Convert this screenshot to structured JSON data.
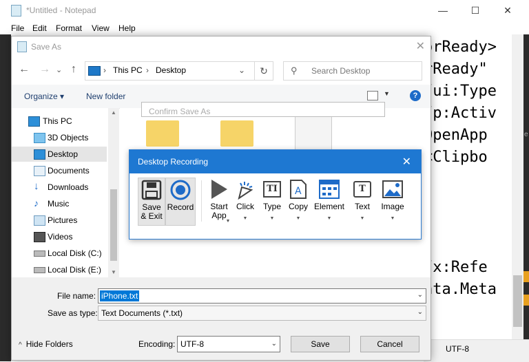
{
  "notepad": {
    "title": "*Untitled - Notepad",
    "menu": [
      "File",
      "Edit",
      "Format",
      "View",
      "Help"
    ],
    "code_lines": [
      "orReady>",
      "rReady\"",
      "/ui:Type",
      "/p:Activ",
      "OpenApp",
      "<Clipbo",
      "",
      "",
      "",
      "/x:Refe",
      "ata.Meta"
    ],
    "status_encoding": "UTF-8"
  },
  "saveas": {
    "title": "Save As",
    "address": [
      "This PC",
      "Desktop"
    ],
    "search_placeholder": "Search Desktop",
    "toolbar": {
      "organize": "Organize",
      "new_folder": "New folder"
    },
    "tree": [
      {
        "label": "This PC",
        "icon": "computer-icon",
        "indent": 0
      },
      {
        "label": "3D Objects",
        "icon": "cube-icon",
        "indent": 1
      },
      {
        "label": "Desktop",
        "icon": "desktop-icon",
        "indent": 1,
        "selected": true
      },
      {
        "label": "Documents",
        "icon": "documents-icon",
        "indent": 1
      },
      {
        "label": "Downloads",
        "icon": "download-icon",
        "indent": 1
      },
      {
        "label": "Music",
        "icon": "music-icon",
        "indent": 1
      },
      {
        "label": "Pictures",
        "icon": "pictures-icon",
        "indent": 1
      },
      {
        "label": "Videos",
        "icon": "videos-icon",
        "indent": 1
      },
      {
        "label": "Local Disk (C:)",
        "icon": "drive-icon",
        "indent": 1
      },
      {
        "label": "Local Disk (E:)",
        "icon": "drive-icon",
        "indent": 1
      }
    ],
    "confirm_behind_title": "Confirm Save As",
    "file_name_label": "File name:",
    "file_name_value": "iPhone.txt",
    "save_type_label": "Save as type:",
    "save_type_value": "Text Documents (*.txt)",
    "hide_folders": "Hide Folders",
    "encoding_label": "Encoding:",
    "encoding_value": "UTF-8",
    "save_button": "Save",
    "cancel_button": "Cancel"
  },
  "recorder": {
    "title": "Desktop Recording",
    "tools": [
      {
        "id": "save-exit",
        "label": "Save\n& Exit",
        "icon": "save-icon",
        "active": true
      },
      {
        "id": "record",
        "label": "Record",
        "icon": "record-icon",
        "active": true
      },
      {
        "id": "start-app",
        "label": "Start\nApp",
        "icon": "play-icon",
        "dropdown": true
      },
      {
        "id": "click",
        "label": "Click",
        "icon": "cursor-click-icon",
        "dropdown": true
      },
      {
        "id": "type",
        "label": "Type",
        "icon": "type-icon",
        "dropdown": true
      },
      {
        "id": "copy",
        "label": "Copy",
        "icon": "copy-text-icon",
        "dropdown": true
      },
      {
        "id": "element",
        "label": "Element",
        "icon": "element-icon",
        "dropdown": true
      },
      {
        "id": "text",
        "label": "Text",
        "icon": "text-icon",
        "dropdown": true
      },
      {
        "id": "image",
        "label": "Image",
        "icon": "image-icon",
        "dropdown": true
      }
    ]
  },
  "colors": {
    "accent": "#1e78d2",
    "selection": "#0078d7",
    "folder": "#f6d468"
  }
}
